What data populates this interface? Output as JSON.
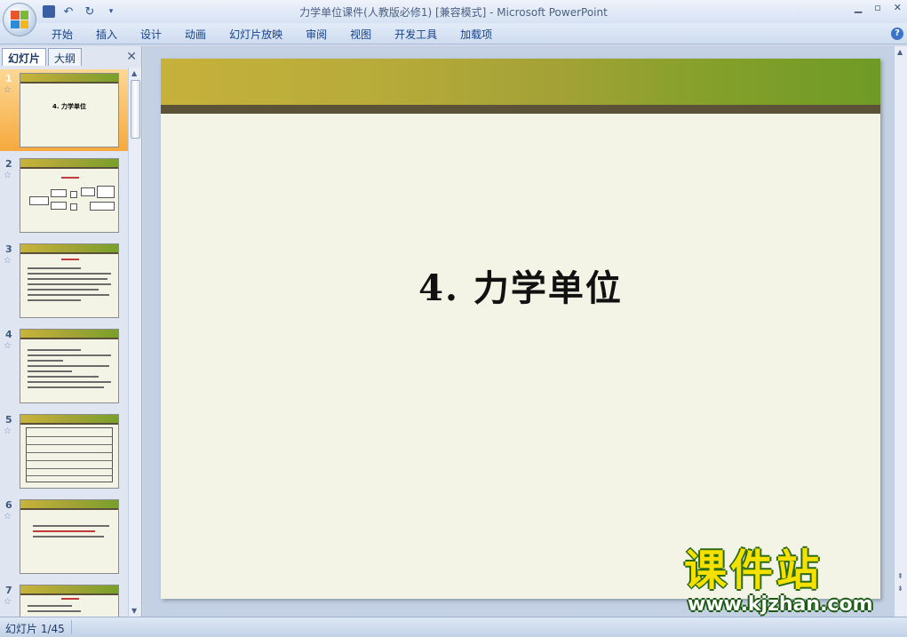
{
  "window": {
    "title": "力学单位课件(人教版必修1) [兼容模式] - Microsoft PowerPoint"
  },
  "ribbon": {
    "tabs": [
      "开始",
      "插入",
      "设计",
      "动画",
      "幻灯片放映",
      "审阅",
      "视图",
      "开发工具",
      "加载项"
    ]
  },
  "pane": {
    "tab_slides": "幻灯片",
    "tab_outline": "大纲",
    "thumbnails": [
      {
        "num": "1",
        "title": "4. 力学单位"
      },
      {
        "num": "2"
      },
      {
        "num": "3"
      },
      {
        "num": "4"
      },
      {
        "num": "5"
      },
      {
        "num": "6"
      },
      {
        "num": "7"
      }
    ]
  },
  "slide": {
    "title": "4.  力学单位"
  },
  "watermark": {
    "brand": "课件站",
    "url": "www.kjzhan.com"
  },
  "status": {
    "slide_counter": "幻灯片 1/45"
  }
}
